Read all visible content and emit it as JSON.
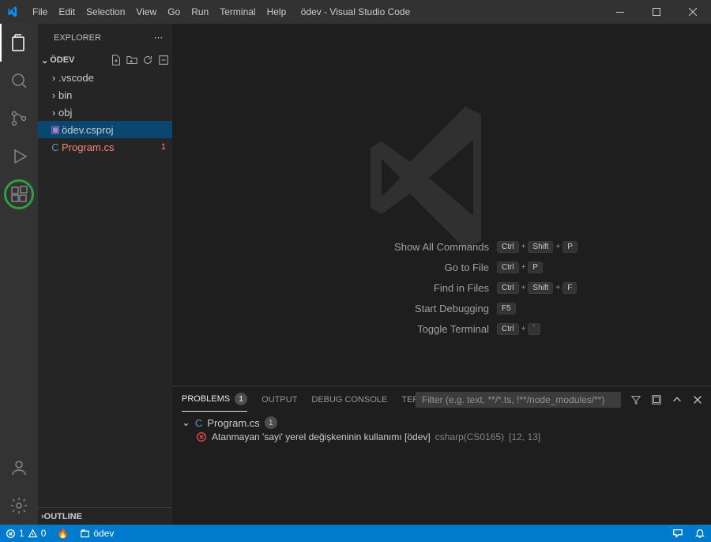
{
  "titlebar": {
    "title": "ödev - Visual Studio Code",
    "menu": [
      "File",
      "Edit",
      "Selection",
      "View",
      "Go",
      "Run",
      "Terminal",
      "Help"
    ]
  },
  "sidebar": {
    "title": "EXPLORER",
    "project": "ÖDEV",
    "tree": {
      "vscode": ".vscode",
      "bin": "bin",
      "obj": "obj",
      "csproj": "ödev.csproj",
      "program": "Program.cs",
      "program_badge": "1"
    },
    "outline": "OUTLINE"
  },
  "welcome": {
    "rows": [
      {
        "label": "Show All Commands",
        "keys": [
          "Ctrl",
          "Shift",
          "P"
        ]
      },
      {
        "label": "Go to File",
        "keys": [
          "Ctrl",
          "P"
        ]
      },
      {
        "label": "Find in Files",
        "keys": [
          "Ctrl",
          "Shift",
          "F"
        ]
      },
      {
        "label": "Start Debugging",
        "keys": [
          "F5"
        ]
      },
      {
        "label": "Toggle Terminal",
        "keys": [
          "Ctrl",
          "`"
        ]
      }
    ]
  },
  "panel": {
    "tabs": {
      "problems": "Problems",
      "problems_count": "1",
      "output": "Output",
      "debug": "Debug Console",
      "terminal": "Terminal"
    },
    "filter_placeholder": "Filter (e.g. text, **/*.ts, !**/node_modules/**)",
    "file": "Program.cs",
    "file_count": "1",
    "error_msg": "Atanmayan 'sayi' yerel değişkeninin kullanımı [ödev]",
    "error_src": "csharp(CS0165)",
    "error_loc": "[12, 13]"
  },
  "statusbar": {
    "errors": "1",
    "warnings": "0",
    "project": "ödev"
  }
}
